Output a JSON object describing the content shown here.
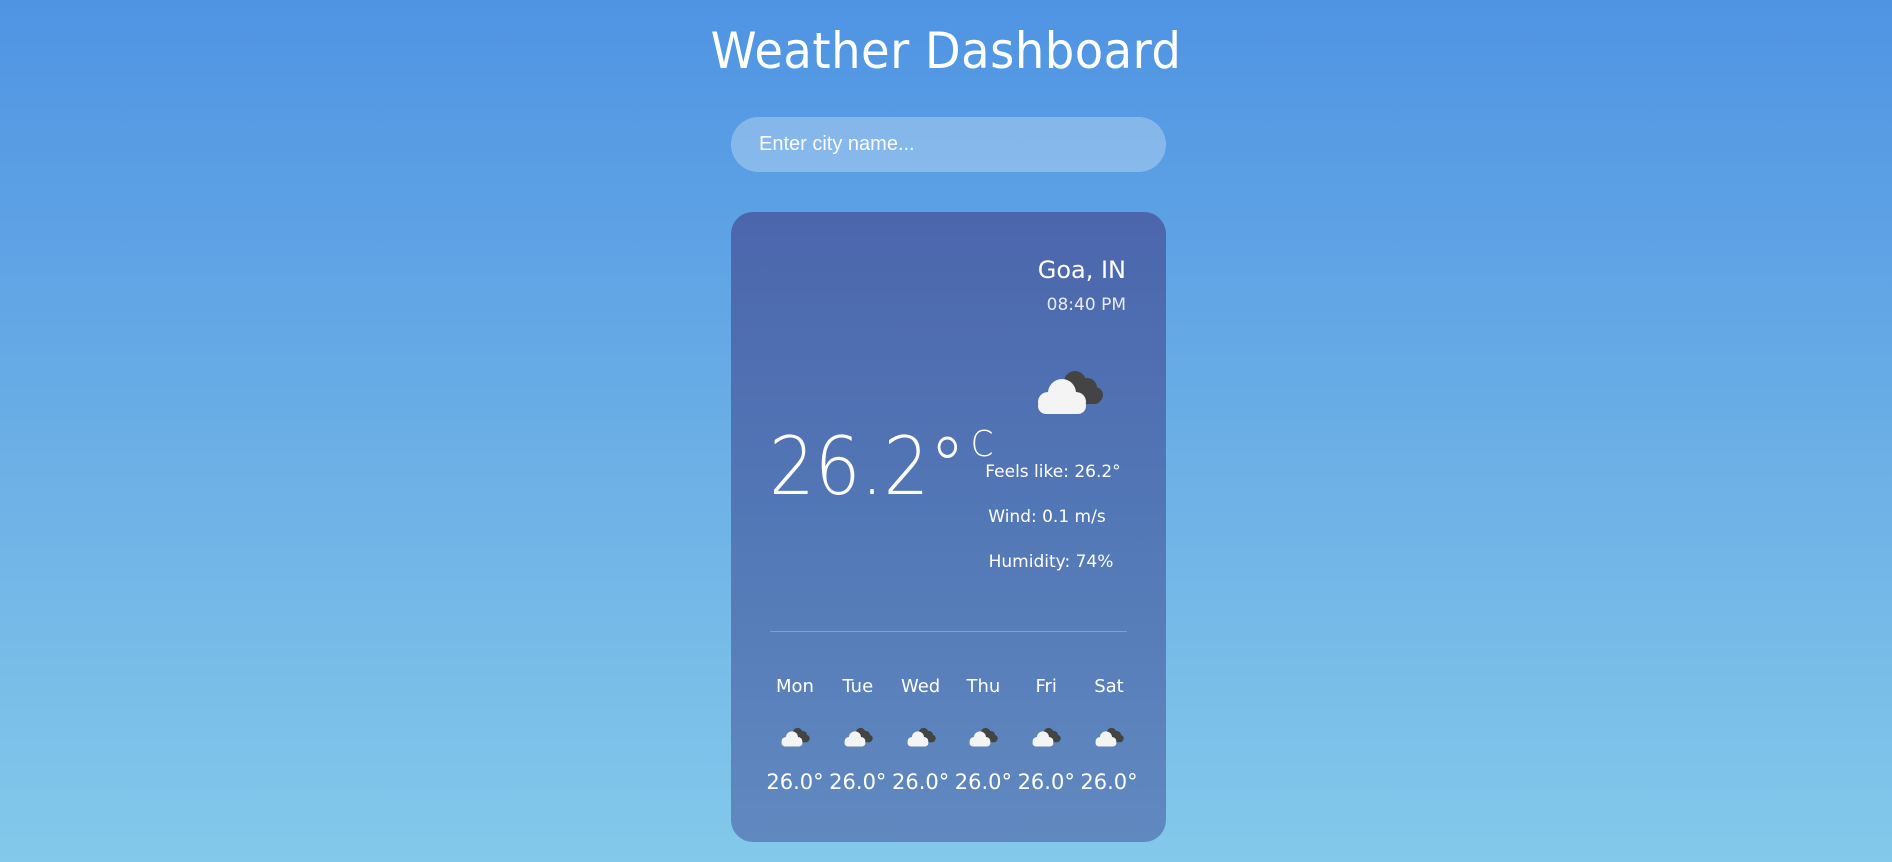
{
  "header": {
    "title": "Weather Dashboard"
  },
  "search": {
    "placeholder": "Enter city name..."
  },
  "current": {
    "location": "Goa, IN",
    "time": "08:40 PM",
    "icon": "cloudy-icon",
    "temperature": "26.2°",
    "unit": "C",
    "feels_like": "Feels like: 26.2°",
    "wind": "Wind: 0.1 m/s",
    "humidity": "Humidity: 74%"
  },
  "forecast": [
    {
      "day": "Mon",
      "icon": "cloudy-icon",
      "temp": "26.0°"
    },
    {
      "day": "Tue",
      "icon": "cloudy-icon",
      "temp": "26.0°"
    },
    {
      "day": "Wed",
      "icon": "cloudy-icon",
      "temp": "26.0°"
    },
    {
      "day": "Thu",
      "icon": "cloudy-icon",
      "temp": "26.0°"
    },
    {
      "day": "Fri",
      "icon": "cloudy-icon",
      "temp": "26.0°"
    },
    {
      "day": "Sat",
      "icon": "cloudy-icon",
      "temp": "26.0°"
    }
  ],
  "colors": {
    "background_top": "#4f94e3",
    "background_bottom": "#83c9ea",
    "card_top": "#4c66ad",
    "card_bottom": "#6189c0",
    "cloud_front": "#f4f4f4",
    "cloud_back": "#444444"
  }
}
